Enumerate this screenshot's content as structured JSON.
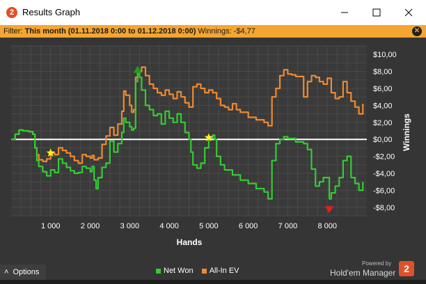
{
  "window": {
    "title": "Results Graph",
    "app_icon_glyph": "2",
    "controls": [
      "minimize-icon",
      "maximize-icon",
      "close-icon"
    ]
  },
  "filter": {
    "label": "Filter:",
    "value": "This month (01.11.2018 0:00 to 01.12.2018 0:00)",
    "winnings_label": "Winnings:",
    "winnings_value": "-$4,77"
  },
  "footer": {
    "options_label": "Options",
    "powered_by": "Powered by",
    "brand": "Hold'em Manager",
    "brand_glyph": "2"
  },
  "colors": {
    "net_won": "#33cc33",
    "all_in_ev": "#f08a30",
    "filter_bar": "#f5a531",
    "background": "#353535"
  },
  "chart_data": {
    "type": "line",
    "xlabel": "Hands",
    "ylabel": "Winnings",
    "xlim": [
      0,
      9000
    ],
    "ylim": [
      -9,
      11
    ],
    "x_ticks": [
      1000,
      2000,
      3000,
      4000,
      5000,
      6000,
      7000,
      8000
    ],
    "x_tick_labels": [
      "1 000",
      "2 000",
      "3 000",
      "4 000",
      "5 000",
      "6 000",
      "7 000",
      "8 000"
    ],
    "y_ticks": [
      10,
      8,
      6,
      4,
      2,
      0,
      -2,
      -4,
      -6,
      -8
    ],
    "y_tick_labels": [
      "$10,00",
      "$8,00",
      "$6,00",
      "$4,00",
      "$2,00",
      "$0,00",
      "-$2,00",
      "-$4,00",
      "-$6,00",
      "-$8,00"
    ],
    "series": [
      {
        "name": "Net Won",
        "color": "#33cc33",
        "points": [
          [
            0,
            0
          ],
          [
            100,
            0.6
          ],
          [
            200,
            1.1
          ],
          [
            300,
            1.0
          ],
          [
            450,
            0.9
          ],
          [
            550,
            0.6
          ],
          [
            600,
            -1.0
          ],
          [
            650,
            -2.5
          ],
          [
            700,
            -3.2
          ],
          [
            800,
            -3.8
          ],
          [
            900,
            -4.3
          ],
          [
            1000,
            -3.6
          ],
          [
            1100,
            -3.9
          ],
          [
            1200,
            -2.3
          ],
          [
            1300,
            -2.8
          ],
          [
            1400,
            -3.3
          ],
          [
            1500,
            -3.7
          ],
          [
            1600,
            -4.0
          ],
          [
            1700,
            -3.9
          ],
          [
            1800,
            -3.2
          ],
          [
            1900,
            -3.4
          ],
          [
            2000,
            -3.8
          ],
          [
            2050,
            -3.2
          ],
          [
            2100,
            -4.8
          ],
          [
            2150,
            -5.8
          ],
          [
            2200,
            -4.5
          ],
          [
            2300,
            -3.3
          ],
          [
            2400,
            -2.8
          ],
          [
            2500,
            -0.2
          ],
          [
            2600,
            -1.5
          ],
          [
            2700,
            -0.5
          ],
          [
            2800,
            0.8
          ],
          [
            2850,
            2.5
          ],
          [
            2900,
            2.0
          ],
          [
            3000,
            1.5
          ],
          [
            3050,
            1.1
          ],
          [
            3100,
            1.3
          ],
          [
            3150,
            6.8
          ],
          [
            3200,
            8.0
          ],
          [
            3250,
            7.3
          ],
          [
            3300,
            5.8
          ],
          [
            3400,
            4.0
          ],
          [
            3500,
            3.5
          ],
          [
            3600,
            2.8
          ],
          [
            3700,
            3.0
          ],
          [
            3800,
            1.8
          ],
          [
            3900,
            3.3
          ],
          [
            4000,
            2.5
          ],
          [
            4100,
            2.0
          ],
          [
            4200,
            3.0
          ],
          [
            4300,
            2.0
          ],
          [
            4400,
            0.8
          ],
          [
            4500,
            0.0
          ],
          [
            4550,
            -1.5
          ],
          [
            4600,
            -3.0
          ],
          [
            4700,
            -3.4
          ],
          [
            4800,
            -2.8
          ],
          [
            4900,
            -1.0
          ],
          [
            5000,
            0.2
          ],
          [
            5100,
            0.5
          ],
          [
            5150,
            0.0
          ],
          [
            5200,
            -2.0
          ],
          [
            5300,
            -3.0
          ],
          [
            5400,
            -3.6
          ],
          [
            5600,
            -4.2
          ],
          [
            5800,
            -4.8
          ],
          [
            6000,
            -5.2
          ],
          [
            6200,
            -5.8
          ],
          [
            6400,
            -6.2
          ],
          [
            6500,
            -7.0
          ],
          [
            6600,
            -2.5
          ],
          [
            6700,
            -0.5
          ],
          [
            6800,
            0.0
          ],
          [
            6900,
            0.3
          ],
          [
            7000,
            0.1
          ],
          [
            7200,
            -0.3
          ],
          [
            7400,
            -0.5
          ],
          [
            7500,
            -1.2
          ],
          [
            7600,
            -3.5
          ],
          [
            7700,
            -5.5
          ],
          [
            7800,
            -5.0
          ],
          [
            7900,
            -4.5
          ],
          [
            8000,
            -4.5
          ],
          [
            8050,
            -7.0
          ],
          [
            8100,
            -6.3
          ],
          [
            8200,
            -5.5
          ],
          [
            8300,
            -4.5
          ],
          [
            8400,
            -2.5
          ],
          [
            8500,
            -2.0
          ],
          [
            8600,
            -4.5
          ],
          [
            8700,
            -5.2
          ],
          [
            8800,
            -6.0
          ],
          [
            8900,
            -5.0
          ]
        ]
      },
      {
        "name": "All-In EV",
        "color": "#f08a30",
        "points": [
          [
            0,
            0
          ],
          [
            100,
            0.6
          ],
          [
            200,
            1.1
          ],
          [
            300,
            1.0
          ],
          [
            450,
            0.9
          ],
          [
            550,
            0.6
          ],
          [
            600,
            -1.0
          ],
          [
            650,
            -1.8
          ],
          [
            700,
            -2.4
          ],
          [
            800,
            -2.6
          ],
          [
            900,
            -2.3
          ],
          [
            1000,
            -1.6
          ],
          [
            1100,
            -1.8
          ],
          [
            1200,
            -1.0
          ],
          [
            1300,
            -1.3
          ],
          [
            1400,
            -1.6
          ],
          [
            1500,
            -2.0
          ],
          [
            1600,
            -2.5
          ],
          [
            1700,
            -2.8
          ],
          [
            1800,
            -1.8
          ],
          [
            1900,
            -2.0
          ],
          [
            2000,
            -2.2
          ],
          [
            2050,
            -1.9
          ],
          [
            2100,
            -2.4
          ],
          [
            2200,
            -2.2
          ],
          [
            2300,
            -0.6
          ],
          [
            2400,
            0.4
          ],
          [
            2500,
            1.4
          ],
          [
            2600,
            0.5
          ],
          [
            2700,
            1.8
          ],
          [
            2800,
            3.3
          ],
          [
            2850,
            5.7
          ],
          [
            2900,
            5.2
          ],
          [
            3000,
            4.0
          ],
          [
            3050,
            3.2
          ],
          [
            3100,
            3.5
          ],
          [
            3150,
            7.3
          ],
          [
            3200,
            8.0
          ],
          [
            3300,
            8.5
          ],
          [
            3400,
            7.5
          ],
          [
            3500,
            6.5
          ],
          [
            3600,
            6.0
          ],
          [
            3700,
            5.5
          ],
          [
            3800,
            5.2
          ],
          [
            3900,
            5.8
          ],
          [
            4000,
            5.3
          ],
          [
            4100,
            4.8
          ],
          [
            4200,
            5.6
          ],
          [
            4300,
            5.0
          ],
          [
            4400,
            4.3
          ],
          [
            4500,
            3.8
          ],
          [
            4600,
            6.2
          ],
          [
            4700,
            6.5
          ],
          [
            4800,
            6.0
          ],
          [
            4900,
            5.5
          ],
          [
            5000,
            5.8
          ],
          [
            5100,
            5.5
          ],
          [
            5200,
            4.8
          ],
          [
            5300,
            4.0
          ],
          [
            5400,
            3.8
          ],
          [
            5500,
            3.5
          ],
          [
            5600,
            4.2
          ],
          [
            5700,
            3.5
          ],
          [
            5800,
            3.2
          ],
          [
            6000,
            2.6
          ],
          [
            6200,
            2.3
          ],
          [
            6400,
            2.0
          ],
          [
            6500,
            1.6
          ],
          [
            6600,
            5.0
          ],
          [
            6700,
            6.0
          ],
          [
            6800,
            7.5
          ],
          [
            6900,
            8.2
          ],
          [
            7000,
            7.7
          ],
          [
            7100,
            7.6
          ],
          [
            7200,
            7.4
          ],
          [
            7300,
            7.4
          ],
          [
            7400,
            5.0
          ],
          [
            7500,
            6.8
          ],
          [
            7600,
            7.5
          ],
          [
            7700,
            7.3
          ],
          [
            7800,
            6.8
          ],
          [
            7900,
            6.5
          ],
          [
            8000,
            7.2
          ],
          [
            8100,
            5.5
          ],
          [
            8200,
            4.8
          ],
          [
            8300,
            5.0
          ],
          [
            8400,
            6.8
          ],
          [
            8500,
            5.5
          ],
          [
            8600,
            4.5
          ],
          [
            8700,
            3.8
          ],
          [
            8800,
            3.0
          ],
          [
            8900,
            4.2
          ]
        ]
      }
    ],
    "markers": [
      {
        "type": "star",
        "x": 1000,
        "y": -1.6,
        "color": "#ffee22"
      },
      {
        "type": "star",
        "x": 5000,
        "y": 0.2,
        "color": "#ffee22"
      },
      {
        "type": "peak",
        "x": 3200,
        "y": 8.0,
        "color": "#1f9e1f"
      },
      {
        "type": "trough",
        "x": 8050,
        "y": -8.2,
        "color": "#e81e1e"
      }
    ],
    "zero_line": true,
    "grid": true,
    "legend_position": "bottom"
  }
}
